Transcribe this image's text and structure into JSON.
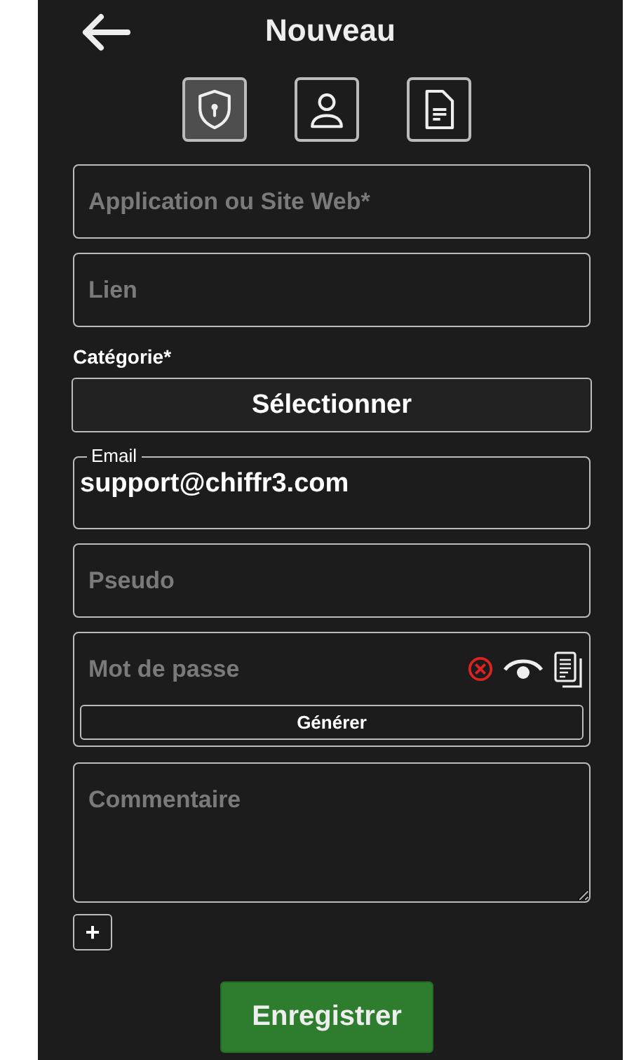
{
  "header": {
    "title": "Nouveau"
  },
  "types": [
    {
      "kind": "password",
      "selected": true
    },
    {
      "kind": "identity",
      "selected": false
    },
    {
      "kind": "note",
      "selected": false
    }
  ],
  "fields": [
    {
      "kind": "text",
      "placeholder": "Application ou Site Web*"
    },
    {
      "kind": "text",
      "placeholder": "Lien"
    },
    {
      "kind": "select",
      "label": "Catégorie*",
      "value": "Sélectionner"
    },
    {
      "kind": "outlined",
      "label": "Email",
      "value": "support@chiffr3.com"
    },
    {
      "kind": "text",
      "placeholder": "Pseudo"
    },
    {
      "kind": "password",
      "placeholder": "Mot de passe",
      "action": "Générer"
    },
    {
      "kind": "textarea",
      "placeholder": "Commentaire"
    }
  ],
  "add_button": {
    "label": "+"
  },
  "save_button": {
    "label": "Enregistrer"
  }
}
